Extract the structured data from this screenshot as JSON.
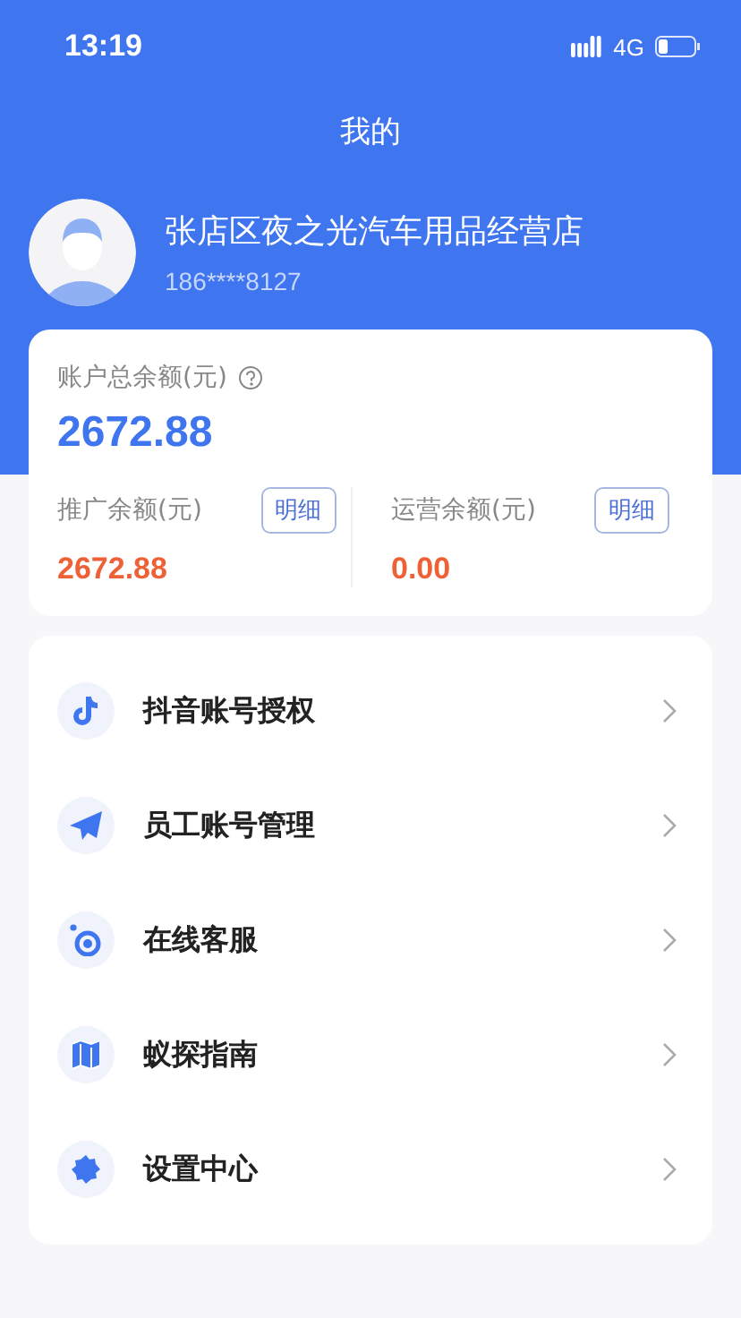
{
  "status_bar": {
    "time": "13:19",
    "network": "4G"
  },
  "header": {
    "title": "我的"
  },
  "profile": {
    "name": "张店区夜之光汽车用品经营店",
    "phone": "186****8127"
  },
  "balance": {
    "label": "账户总余额(元)",
    "amount": "2672.88",
    "sub_accounts": [
      {
        "label": "推广余额(元)",
        "amount": "2672.88",
        "button": "明细"
      },
      {
        "label": "运营余额(元)",
        "amount": "0.00",
        "button": "明细"
      }
    ]
  },
  "menu": [
    {
      "label": "抖音账号授权",
      "kind": "music"
    },
    {
      "label": "员工账号管理",
      "kind": "send"
    },
    {
      "label": "在线客服",
      "kind": "service"
    },
    {
      "label": "蚁探指南",
      "kind": "map"
    },
    {
      "label": "设置中心",
      "kind": "settings"
    }
  ]
}
